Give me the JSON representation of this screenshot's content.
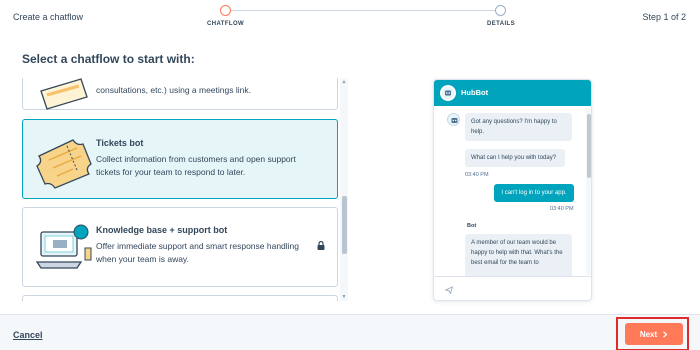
{
  "header": {
    "title": "Create a chatflow",
    "step_indicator": "Step 1 of 2",
    "steps": [
      {
        "label": "CHATFLOW",
        "state": "active"
      },
      {
        "label": "DETAILS",
        "state": "inactive"
      }
    ]
  },
  "main": {
    "section_title": "Select a chatflow to start with:",
    "cards": [
      {
        "title": "",
        "description": "consultations, etc.) using a meetings link.",
        "selected": false,
        "art_icon": "calendar-ticket-icon"
      },
      {
        "title": "Tickets bot",
        "description": "Collect information from customers and open support tickets for your team to respond to later.",
        "selected": true,
        "art_icon": "ticket-icon"
      },
      {
        "title": "Knowledge base + support bot",
        "description": "Offer immediate support and smart response handling when your team is away.",
        "selected": false,
        "art_icon": "laptop-help-icon",
        "locked": true
      }
    ]
  },
  "chat_preview": {
    "bot_name": "HubBot",
    "messages": [
      {
        "from": "bot",
        "text": "Got any questions? I'm happy to help."
      },
      {
        "from": "bot",
        "text": "What can I help you with today?"
      },
      {
        "from": "ts",
        "text": "03:40 PM"
      },
      {
        "from": "user",
        "text": "I can't log in to your app."
      },
      {
        "from": "ts",
        "text": "03:40 PM"
      },
      {
        "from": "bot_label",
        "text": "Bot"
      },
      {
        "from": "bot",
        "text": "A member of our team would be happy to help with that. What's the best email for the team to"
      }
    ]
  },
  "footer": {
    "cancel_label": "Cancel",
    "next_label": "Next",
    "next_icon": "chevron-right-icon"
  },
  "colors": {
    "accent_teal": "#00a4bd",
    "accent_orange": "#ff7a59",
    "text_dark": "#33475b",
    "highlight_red": "#e02b2b"
  }
}
